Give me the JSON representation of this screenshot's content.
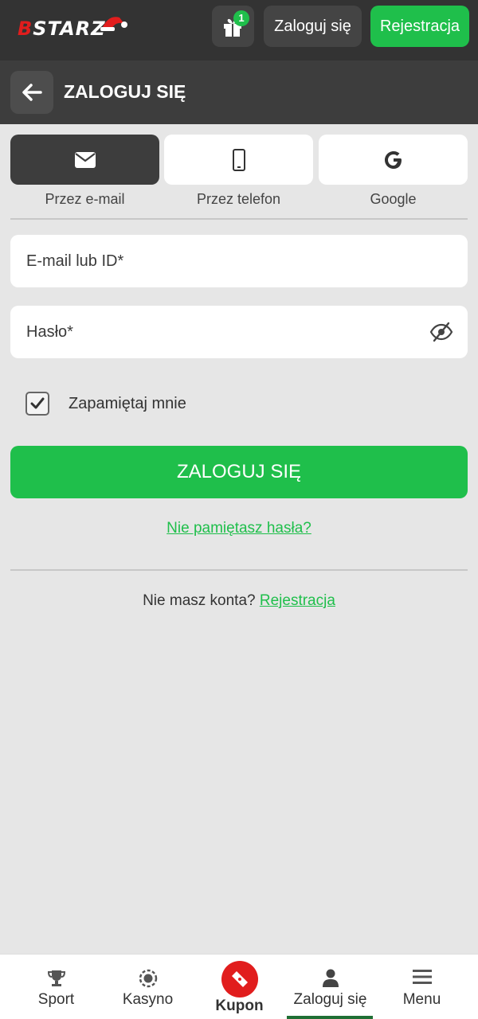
{
  "header": {
    "logo_text_b": "B",
    "logo_text_rest": "STARZ",
    "gift_badge": "1",
    "login_label": "Zaloguj się",
    "register_label": "Rejestracja"
  },
  "titlebar": {
    "title": "ZALOGUJ SIĘ"
  },
  "methods": [
    {
      "label": "Przez e-mail",
      "icon": "envelope-icon",
      "active": true
    },
    {
      "label": "Przez telefon",
      "icon": "phone-icon",
      "active": false
    },
    {
      "label": "Google",
      "icon": "google-icon",
      "active": false
    }
  ],
  "form": {
    "email_placeholder": "E-mail lub ID*",
    "email_value": "",
    "password_placeholder": "Hasło*",
    "password_value": "",
    "remember_label": "Zapamiętaj mnie",
    "remember_checked": true,
    "submit_label": "ZALOGUJ SIĘ",
    "forgot_label": "Nie pamiętasz hasła?",
    "no_account_text": "Nie masz konta?",
    "register_link": "Rejestracja"
  },
  "bottom_nav": [
    {
      "label": "Sport",
      "icon": "trophy-icon"
    },
    {
      "label": "Kasyno",
      "icon": "casino-chip-icon"
    },
    {
      "label": "Kupon",
      "icon": "ticket-icon"
    },
    {
      "label": "Zaloguj się",
      "icon": "user-icon",
      "active": true
    },
    {
      "label": "Menu",
      "icon": "menu-icon"
    }
  ],
  "colors": {
    "accent_green": "#1fbf4b",
    "header_dark": "#333333",
    "brand_red": "#e11d1d",
    "background": "#e6e6e6"
  }
}
